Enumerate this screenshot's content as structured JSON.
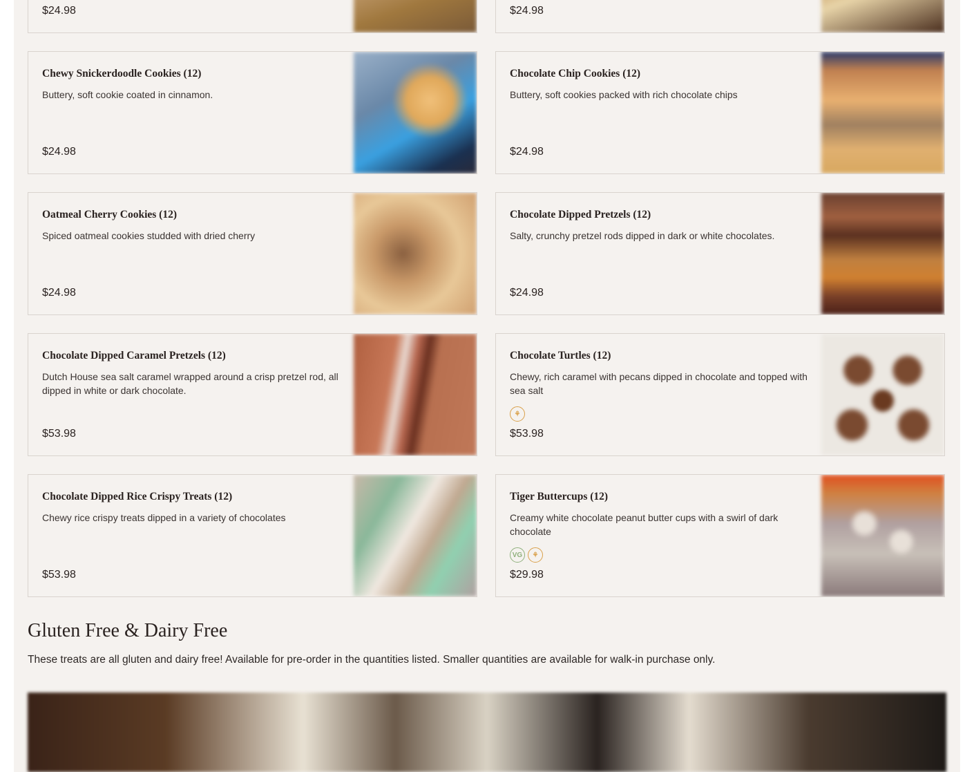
{
  "products": [
    {
      "name": "",
      "description": "",
      "price": "$24.98",
      "icons": []
    },
    {
      "name": "",
      "description": "",
      "price": "$24.98",
      "icons": []
    },
    {
      "name": "Chewy Snickerdoodle Cookies (12)",
      "description": "Buttery, soft cookie coated in cinnamon.",
      "price": "$24.98",
      "icons": []
    },
    {
      "name": "Chocolate Chip Cookies (12)",
      "description": "Buttery, soft cookies packed with rich chocolate chips",
      "price": "$24.98",
      "icons": []
    },
    {
      "name": "Oatmeal Cherry Cookies (12)",
      "description": "Spiced oatmeal cookies studded with dried cherry",
      "price": "$24.98",
      "icons": []
    },
    {
      "name": "Chocolate Dipped Pretzels (12)",
      "description": "Salty, crunchy pretzel rods dipped in dark or white chocolates.",
      "price": "$24.98",
      "icons": []
    },
    {
      "name": "Chocolate Dipped Caramel Pretzels (12)",
      "description": "Dutch House sea salt caramel wrapped around a crisp pretzel rod, all dipped in white or dark chocolate.",
      "price": "$53.98",
      "icons": []
    },
    {
      "name": "Chocolate Turtles (12)",
      "description": "Chewy, rich caramel with pecans dipped in chocolate and topped with sea salt",
      "price": "$53.98",
      "icons": [
        "gluten-free-icon"
      ]
    },
    {
      "name": "Chocolate Dipped Rice Crispy Treats (12)",
      "description": "Chewy rice crispy treats dipped in a variety of chocolates",
      "price": "$53.98",
      "icons": []
    },
    {
      "name": "Tiger Buttercups (12)",
      "description": "Creamy white chocolate peanut butter cups with a swirl of dark chocolate",
      "price": "$29.98",
      "icons": [
        "vegan-icon",
        "gluten-free-icon"
      ]
    }
  ],
  "section": {
    "title": "Gluten Free & Dairy Free",
    "intro": "These treats are all gluten and dairy free! Available for pre-order in the quantities listed. Smaller quantities are available for walk-in purchase only."
  },
  "badges": {
    "vg_label": "VG",
    "gf_symbol": "⚘"
  },
  "colors": {
    "page_bg": "#f5f2ef",
    "card_border": "#d9d3ce",
    "gf_badge": "#d9a04a",
    "vg_badge": "#8fb07c"
  }
}
